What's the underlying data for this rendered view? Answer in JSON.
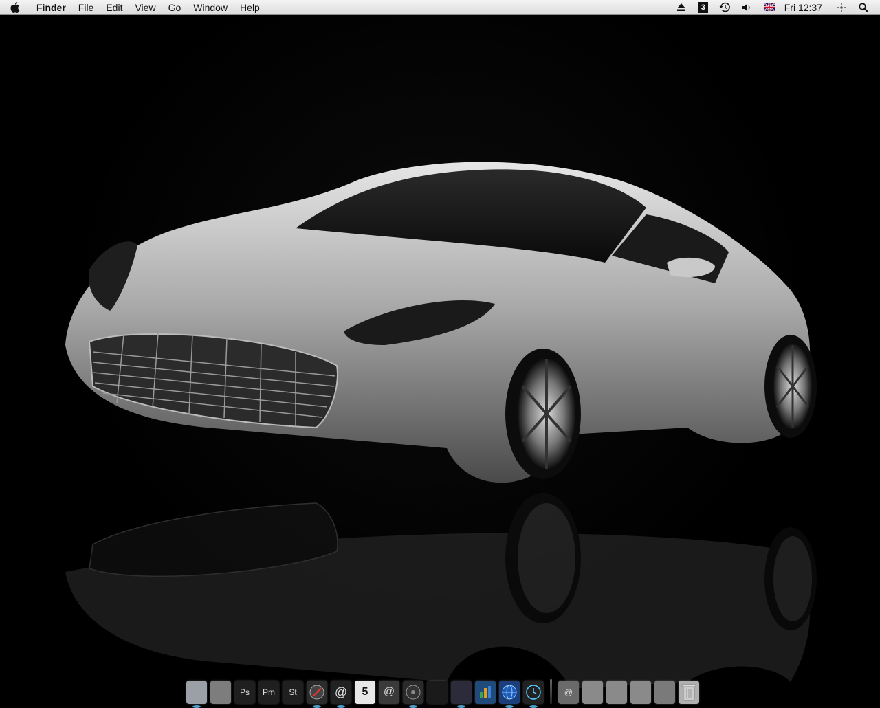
{
  "menubar": {
    "app_name": "Finder",
    "items": [
      "File",
      "Edit",
      "View",
      "Go",
      "Window",
      "Help"
    ],
    "status_icons": [
      "eject-icon",
      "scripts-icon",
      "time-machine-icon",
      "volume-icon",
      "uk-flag-icon",
      "spaces-icon",
      "spotlight-icon"
    ],
    "clock": "Fri 12:37",
    "scripts_badge": "3"
  },
  "dock": {
    "apps": [
      {
        "name": "finder-icon",
        "label": "",
        "color": "#9aa0a6",
        "running": true
      },
      {
        "name": "system-preferences-icon",
        "label": "",
        "color": "#7d7d7d",
        "running": false
      },
      {
        "name": "photoshop-icon",
        "label": "Ps",
        "color": "#1f1f1f",
        "running": false
      },
      {
        "name": "pagemaker-icon",
        "label": "Pm",
        "color": "#1f1f1f",
        "running": false
      },
      {
        "name": "stuffit-icon",
        "label": "St",
        "color": "#1f1f1f",
        "running": false
      },
      {
        "name": "safari-icon",
        "label": "",
        "color": "#2c2c2c",
        "running": true
      },
      {
        "name": "mail-icon",
        "label": "@",
        "color": "#222222",
        "running": true
      },
      {
        "name": "ical-icon",
        "label": "5",
        "color": "#e8e8e8",
        "running": false
      },
      {
        "name": "address-book-icon",
        "label": "@",
        "color": "#3a3a3a",
        "running": false
      },
      {
        "name": "itunes-icon",
        "label": "",
        "color": "#2a2a2a",
        "running": true
      },
      {
        "name": "terminal-icon",
        "label": "",
        "color": "#1a1a1a",
        "running": false
      },
      {
        "name": "script-editor-icon",
        "label": "",
        "color": "#2b2b3b",
        "running": true
      },
      {
        "name": "activity-monitor-icon",
        "label": "",
        "color": "#204a7a",
        "running": false
      },
      {
        "name": "network-globe-icon",
        "label": "",
        "color": "#1a3f7a",
        "running": true
      },
      {
        "name": "time-machine-app-icon",
        "label": "",
        "color": "#222222",
        "running": true
      }
    ],
    "stacks": [
      {
        "name": "mail-stack-icon",
        "label": "@",
        "color": "#6a6a6a"
      },
      {
        "name": "documents-folder-icon",
        "label": "",
        "color": "#8a8a8a"
      },
      {
        "name": "downloads-folder-icon",
        "label": "",
        "color": "#8a8a8a"
      },
      {
        "name": "applications-folder-icon",
        "label": "",
        "color": "#8a8a8a"
      },
      {
        "name": "drive-stack-icon",
        "label": "",
        "color": "#7a7a7a"
      },
      {
        "name": "trash-icon",
        "label": "",
        "color": "#b0b0b0"
      }
    ]
  }
}
